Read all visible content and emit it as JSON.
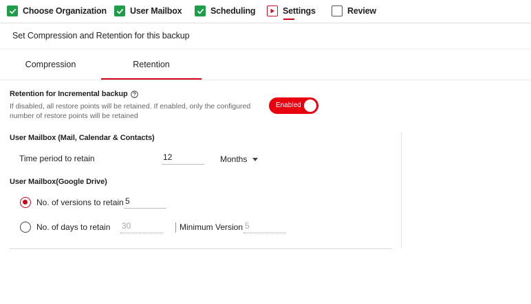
{
  "wizard": {
    "steps": [
      {
        "label": "Choose Organization",
        "state": "done"
      },
      {
        "label": "User Mailbox",
        "state": "done"
      },
      {
        "label": "Scheduling",
        "state": "done"
      },
      {
        "label": "Settings",
        "state": "current"
      },
      {
        "label": "Review",
        "state": "todo"
      }
    ]
  },
  "header": {
    "title": "Set Compression and Retention for this backup"
  },
  "tabs": [
    {
      "label": "Compression",
      "active": false
    },
    {
      "label": "Retention",
      "active": true
    }
  ],
  "retention": {
    "title": "Retention for Incremental backup",
    "description": "If disabled, all restore points will be retained. If enabled, only the configured number of restore points will be retained",
    "toggle_label": "Enabled",
    "toggle_on": true
  },
  "mailbox": {
    "title": "User Mailbox (Mail, Calendar & Contacts)",
    "time_label": "Time period to retain",
    "time_value": "12",
    "unit": "Months"
  },
  "drive": {
    "title": "User Mailbox(Google Drive)",
    "versions_label": "No. of versions to retain",
    "versions_value": "5",
    "versions_selected": true,
    "days_label": "No. of days to retain",
    "days_value": "30",
    "min_version_label": "Minimum Version",
    "min_version_value": "5"
  },
  "colors": {
    "accent": "#d0021b",
    "toggle": "#e8000f",
    "done": "#1f9d4a"
  },
  "icons": {
    "done": "check-icon",
    "current": "play-icon",
    "help": "question-circle-icon",
    "dropdown": "chevron-down-icon"
  }
}
